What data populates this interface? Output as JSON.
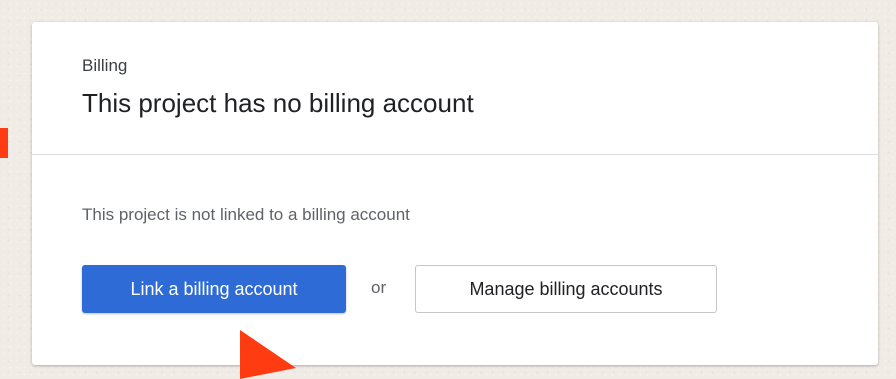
{
  "billing_card": {
    "header": {
      "label": "Billing",
      "title": "This project has no billing account"
    },
    "body": {
      "description": "This project is not linked to a billing account",
      "link_button_label": "Link a billing account",
      "separator_text": "or",
      "manage_button_label": "Manage billing accounts"
    }
  },
  "colors": {
    "primary_button": "#2e6bd6",
    "annotation": "#ff3b12",
    "background": "#f0ebe5"
  }
}
